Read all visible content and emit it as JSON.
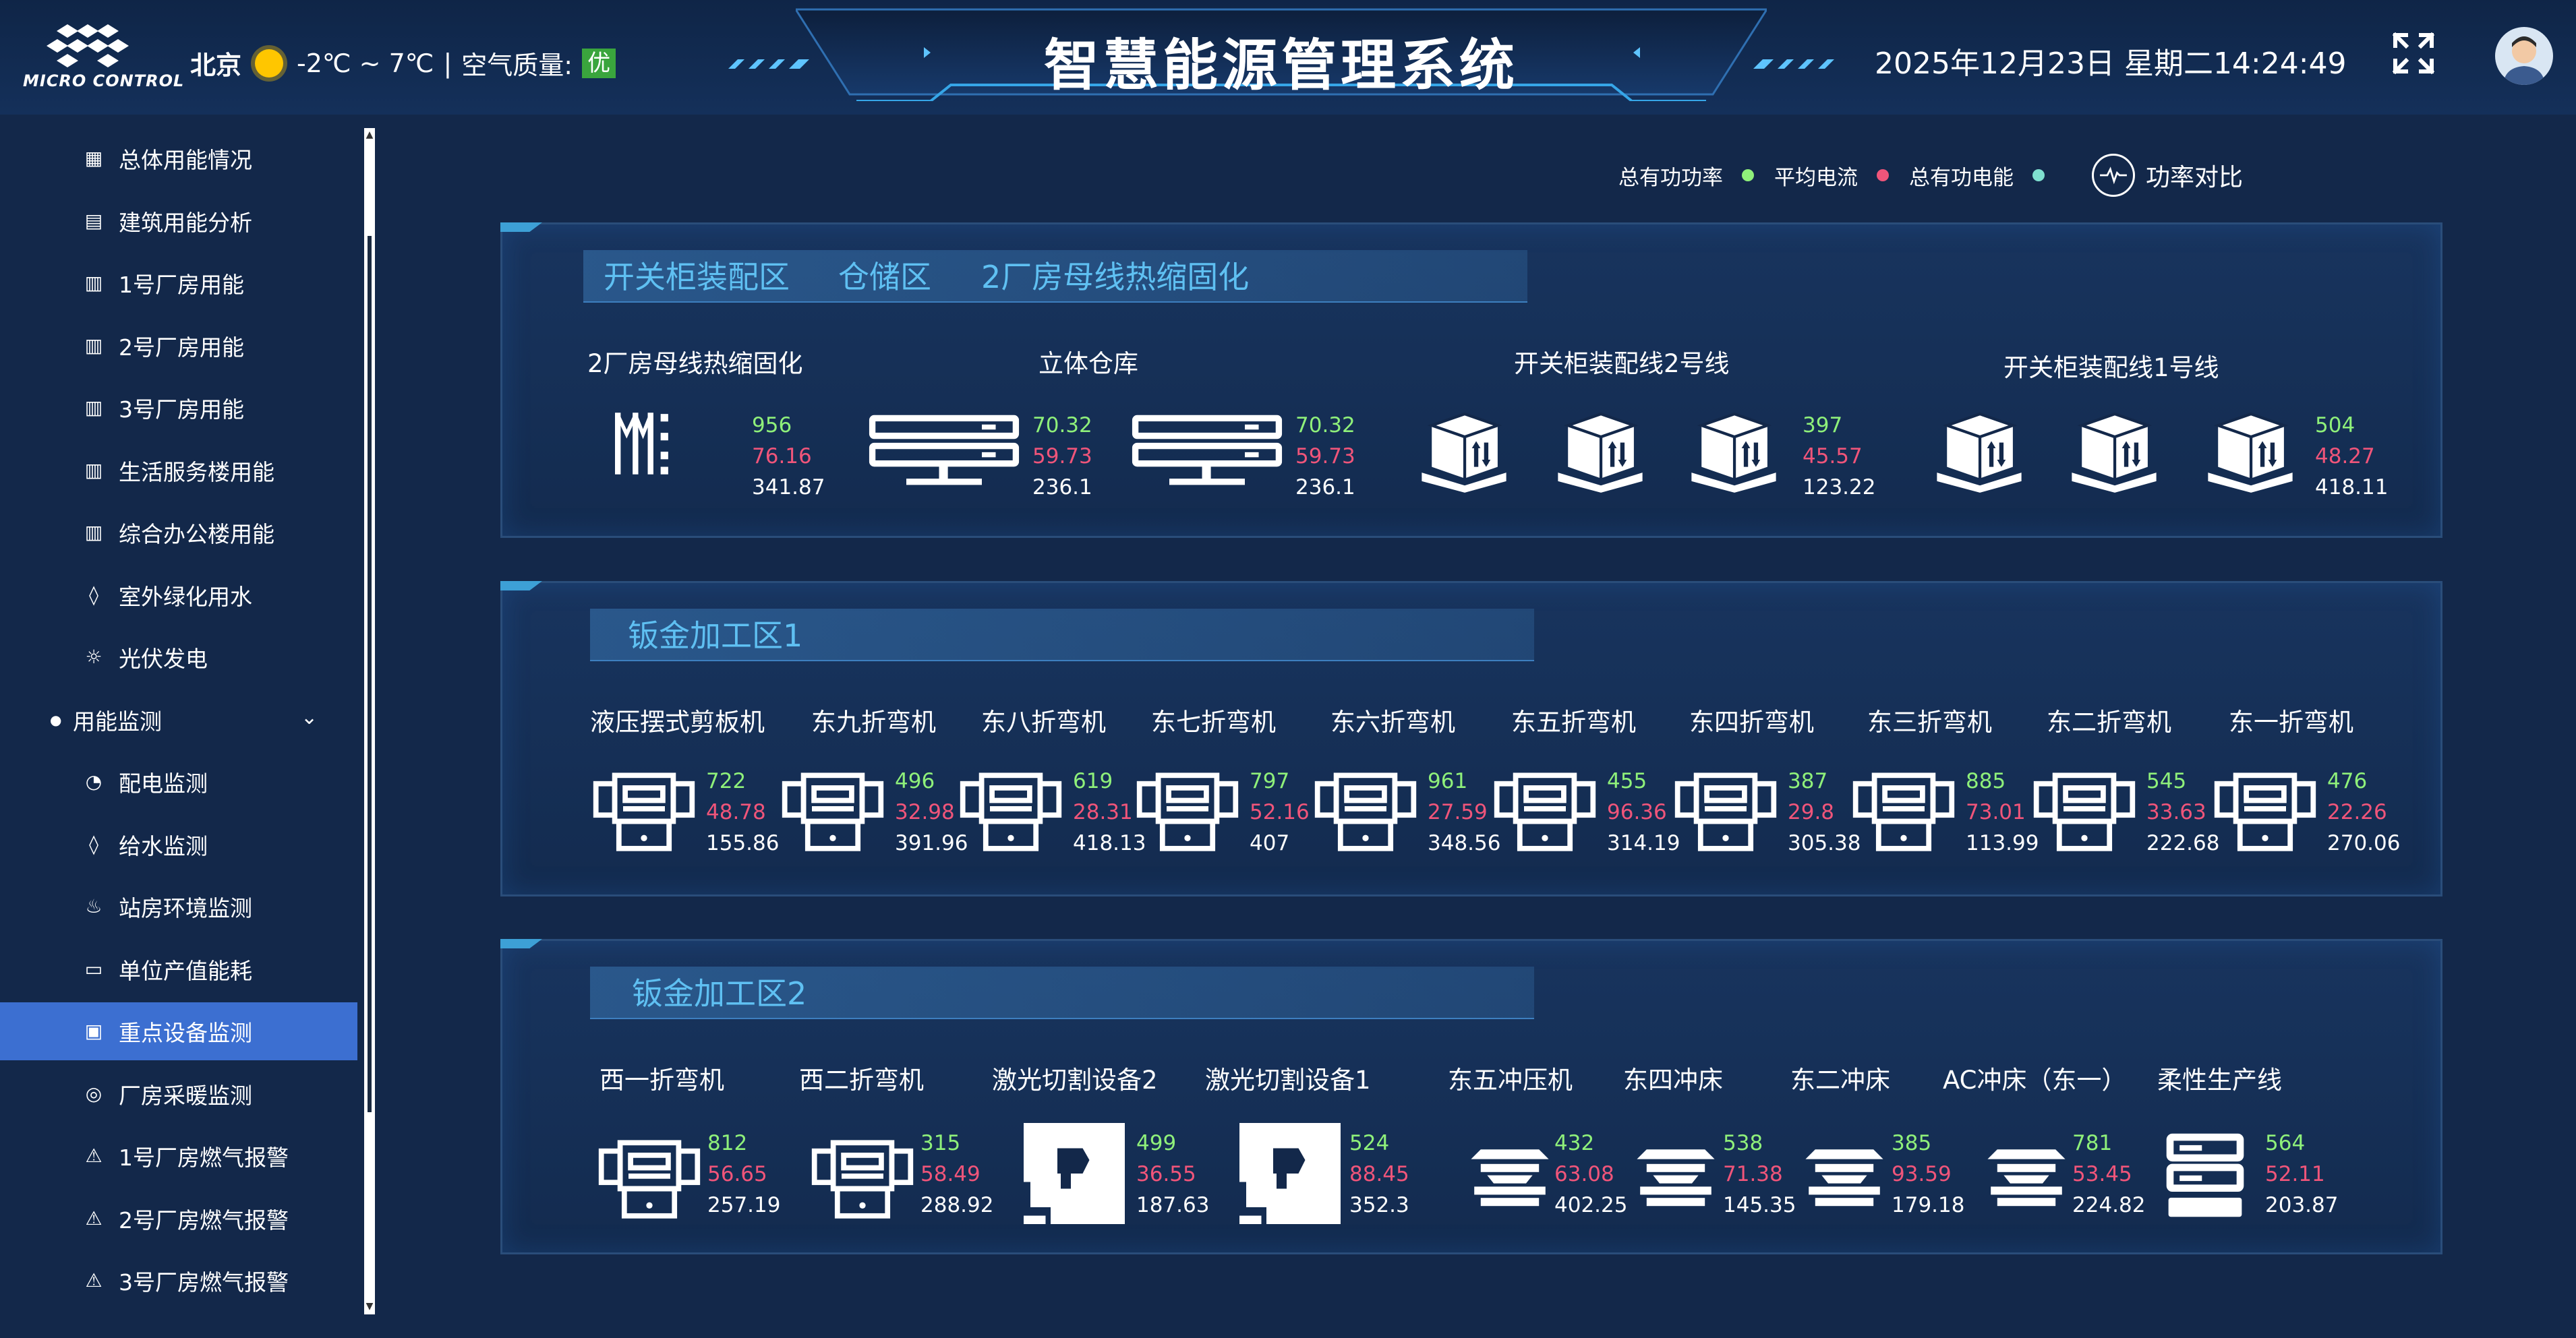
{
  "header": {
    "logo_text": "MICRO CONTROL",
    "city": "北京",
    "temperature": "-2℃ ~ 7℃",
    "separator": "|",
    "air_quality_label": "空气质量:",
    "air_quality_value": "优",
    "title": "智慧能源管理系统",
    "datetime": "2025年12月23日 星期二14:24:49"
  },
  "sidebar": {
    "items": [
      {
        "label": "总体用能情况",
        "icon": "dashboard-icon"
      },
      {
        "label": "建筑用能分析",
        "icon": "chart-icon"
      },
      {
        "label": "1号厂房用能",
        "icon": "bar-chart-icon"
      },
      {
        "label": "2号厂房用能",
        "icon": "bar-chart-icon"
      },
      {
        "label": "3号厂房用能",
        "icon": "bar-chart-icon"
      },
      {
        "label": "生活服务楼用能",
        "icon": "bar-chart-icon"
      },
      {
        "label": "综合办公楼用能",
        "icon": "bar-chart-icon"
      },
      {
        "label": "室外绿化用水",
        "icon": "water-drop-icon"
      },
      {
        "label": "光伏发电",
        "icon": "solar-icon"
      },
      {
        "label": "用能监测",
        "icon": "bullet-icon"
      },
      {
        "label": "配电监测",
        "icon": "gauge-icon"
      },
      {
        "label": "给水监测",
        "icon": "water-drop-icon"
      },
      {
        "label": "站房环境监测",
        "icon": "environment-icon"
      },
      {
        "label": "单位产值能耗",
        "icon": "monitor-icon"
      },
      {
        "label": "重点设备监测",
        "icon": "device-icon"
      },
      {
        "label": "厂房采暖监测",
        "icon": "heating-icon"
      },
      {
        "label": "1号厂房燃气报警",
        "icon": "warning-icon"
      },
      {
        "label": "2号厂房燃气报警",
        "icon": "warning-icon"
      },
      {
        "label": "3号厂房燃气报警",
        "icon": "warning-icon"
      }
    ]
  },
  "legend": {
    "items": [
      {
        "label": "总有功功率",
        "color": "#8ff07a"
      },
      {
        "label": "平均电流",
        "color": "#f0557a"
      },
      {
        "label": "总有功电能",
        "color": "#7fe0d0"
      }
    ],
    "compare_label": "功率对比"
  },
  "panels": [
    {
      "title_parts": [
        "开关柜装配区",
        "仓储区",
        "2厂房母线热缩固化"
      ],
      "groups": [
        {
          "label": "2厂房母线热缩固化",
          "values": [
            "956",
            "76.16",
            "341.87"
          ]
        },
        {
          "label": "立体仓库",
          "values": [
            "70.32",
            "59.73",
            "236.1"
          ]
        },
        {
          "label": "",
          "values": [
            "70.32",
            "59.73",
            "236.1"
          ]
        },
        {
          "label": "开关柜装配线2号线",
          "values": [
            "397",
            "45.57",
            "123.22"
          ]
        },
        {
          "label": "开关柜装配线1号线",
          "values": [
            "504",
            "48.27",
            "418.11"
          ]
        }
      ]
    },
    {
      "title_parts": [
        "钣金加工区1"
      ],
      "devices": [
        {
          "label": "液压摆式剪板机",
          "values": [
            "722",
            "48.78",
            "155.86"
          ]
        },
        {
          "label": "东九折弯机",
          "values": [
            "496",
            "32.98",
            "391.96"
          ]
        },
        {
          "label": "东八折弯机",
          "values": [
            "619",
            "28.31",
            "418.13"
          ]
        },
        {
          "label": "东七折弯机",
          "values": [
            "797",
            "52.16",
            "407"
          ]
        },
        {
          "label": "东六折弯机",
          "values": [
            "961",
            "27.59",
            "348.56"
          ]
        },
        {
          "label": "东五折弯机",
          "values": [
            "455",
            "96.36",
            "314.19"
          ]
        },
        {
          "label": "东四折弯机",
          "values": [
            "387",
            "29.8",
            "305.38"
          ]
        },
        {
          "label": "东三折弯机",
          "values": [
            "885",
            "73.01",
            "113.99"
          ]
        },
        {
          "label": "东二折弯机",
          "values": [
            "545",
            "33.63",
            "222.68"
          ]
        },
        {
          "label": "东一折弯机",
          "values": [
            "476",
            "22.26",
            "270.06"
          ]
        }
      ]
    },
    {
      "title_parts": [
        "钣金加工区2"
      ],
      "devices": [
        {
          "label": "西一折弯机",
          "values": [
            "812",
            "56.65",
            "257.19"
          ],
          "type": "bender"
        },
        {
          "label": "西二折弯机",
          "values": [
            "315",
            "58.49",
            "288.92"
          ],
          "type": "bender"
        },
        {
          "label": "激光切割设备2",
          "values": [
            "499",
            "36.55",
            "187.63"
          ],
          "type": "laser"
        },
        {
          "label": "激光切割设备1",
          "values": [
            "524",
            "88.45",
            "352.3"
          ],
          "type": "laser"
        },
        {
          "label": "东五冲压机",
          "values": [
            "432",
            "63.08",
            "402.25"
          ],
          "type": "press"
        },
        {
          "label": "东四冲床",
          "values": [
            "538",
            "71.38",
            "145.35"
          ],
          "type": "press"
        },
        {
          "label": "东二冲床",
          "values": [
            "385",
            "93.59",
            "179.18"
          ],
          "type": "press"
        },
        {
          "label": "AC冲床（东一）",
          "values": [
            "781",
            "53.45",
            "224.82"
          ],
          "type": "press"
        },
        {
          "label": "柔性生产线",
          "values": [
            "564",
            "52.11",
            "203.87"
          ],
          "type": "server"
        }
      ]
    }
  ]
}
